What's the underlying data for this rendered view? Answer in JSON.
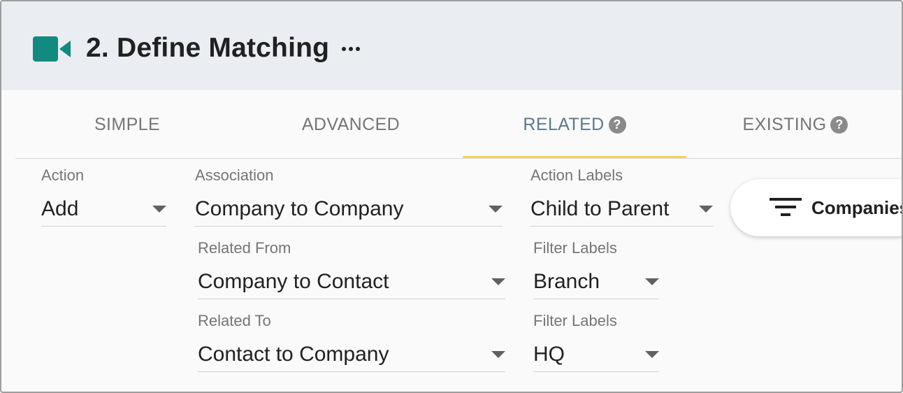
{
  "header": {
    "title": "2. Define Matching",
    "icon": "video-camera-icon",
    "icon_color": "#128a80",
    "more_icon": "more-horizontal-icon"
  },
  "tabs": [
    {
      "label": "SIMPLE",
      "active": false,
      "help": false
    },
    {
      "label": "ADVANCED",
      "active": false,
      "help": false
    },
    {
      "label": "RELATED",
      "active": true,
      "help": true
    },
    {
      "label": "EXISTING",
      "active": false,
      "help": true
    }
  ],
  "help_glyph": "?",
  "accent_color": "#f7d354",
  "form": {
    "action": {
      "label": "Action",
      "value": "Add"
    },
    "association": {
      "label": "Association",
      "value": "Company to Company"
    },
    "action_labels": {
      "label": "Action Labels",
      "value": "Child to Parent"
    },
    "related_from": {
      "label": "Related From",
      "value": "Company to Contact"
    },
    "filter_labels_1": {
      "label": "Filter Labels",
      "value": "Branch"
    },
    "related_to": {
      "label": "Related To",
      "value": "Contact to Company"
    },
    "filter_labels_2": {
      "label": "Filter Labels",
      "value": "HQ"
    }
  },
  "filter_button": {
    "icon": "filter-icon",
    "label": "Companies"
  }
}
